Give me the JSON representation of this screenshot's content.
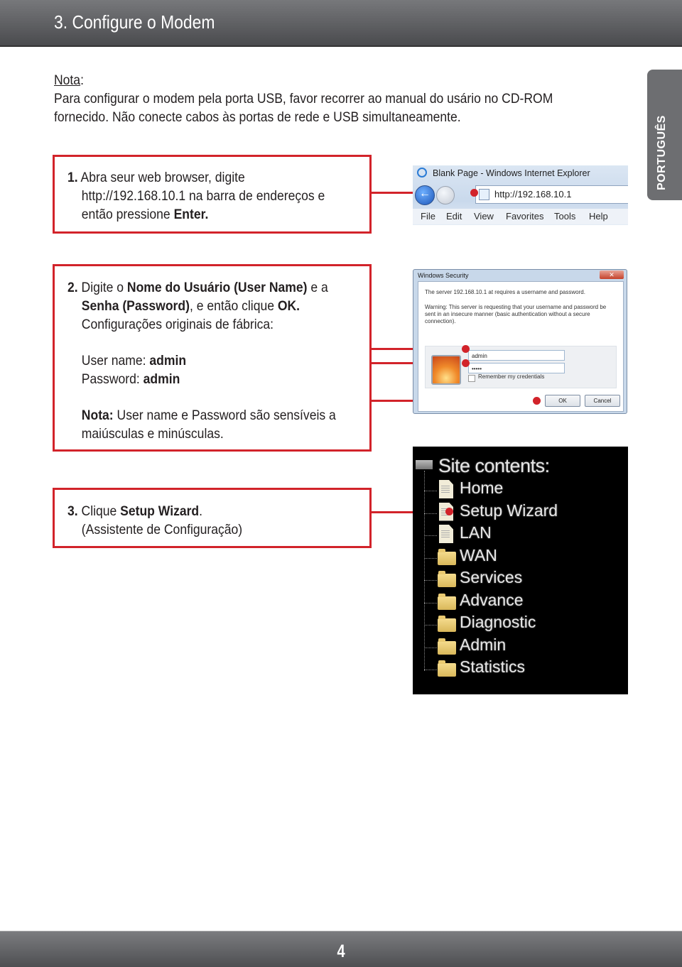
{
  "header": {
    "title": "3. Configure o Modem"
  },
  "language_tab": {
    "label": "PORTUGUÊS"
  },
  "note": {
    "label": "Nota",
    "colon": ":",
    "line1": "Para configurar o modem pela porta USB, favor recorrer ao manual do usário no CD-ROM",
    "line2": "fornecido. Não conecte cabos às portas de rede e USB simultaneamente."
  },
  "steps": [
    {
      "number": "1.",
      "line1": "Abra seur web browser, digite",
      "line2": "http://192.168.10.1 na barra de  endereços e",
      "line3_prefix": "então pressione ",
      "line3_bold": "Enter."
    },
    {
      "number": "2.",
      "line1_a": "Digite o ",
      "line1_b": "Nome do Usuário (User Name)",
      "line1_c": " e a",
      "line2_a": "Senha (Password)",
      "line2_b": ", e então clique ",
      "line2_c": "OK.",
      "line3": "Configurações originais de fábrica:",
      "username_label": "User name: ",
      "username_value": "admin",
      "password_label": "Password: ",
      "password_value": "admin",
      "note_label": "Nota:",
      "note_line1": " User name e Password são sensíveis a",
      "note_line2": "maiúsculas e minúsculas."
    },
    {
      "number": "3.",
      "line1_a": "Clique ",
      "line1_b": "Setup Wizard",
      "line1_c": ".",
      "line2": "(Assistente de Configuração)"
    }
  ],
  "browser": {
    "title": "Blank Page - Windows Internet Explorer",
    "url": "http://192.168.10.1",
    "menu": [
      "File",
      "Edit",
      "View",
      "Favorites",
      "Tools",
      "Help"
    ]
  },
  "security_dialog": {
    "title": "Windows Security",
    "close": "✕",
    "message": "The server 192.168.10.1 at  requires a username and password.",
    "warning1": "Warning: This server is requesting that your username and password be",
    "warning2": "sent in an insecure manner (basic authentication without a secure",
    "warning3": "connection).",
    "username_value": "admin",
    "password_value": "•••••",
    "remember_label": "Remember my credentials",
    "ok_label": "OK",
    "cancel_label": "Cancel"
  },
  "site_contents": {
    "title": "Site contents:",
    "items": [
      {
        "label": "Home",
        "icon": "page"
      },
      {
        "label": "Setup Wizard",
        "icon": "page"
      },
      {
        "label": "LAN",
        "icon": "page"
      },
      {
        "label": "WAN",
        "icon": "folder"
      },
      {
        "label": "Services",
        "icon": "folder"
      },
      {
        "label": "Advance",
        "icon": "folder"
      },
      {
        "label": "Diagnostic",
        "icon": "folder"
      },
      {
        "label": "Admin",
        "icon": "folder"
      },
      {
        "label": "Statistics",
        "icon": "folder"
      }
    ]
  },
  "footer": {
    "page_number": "4"
  },
  "colors": {
    "accent_red": "#d2232a",
    "header_gray": "#5a5b5e"
  }
}
